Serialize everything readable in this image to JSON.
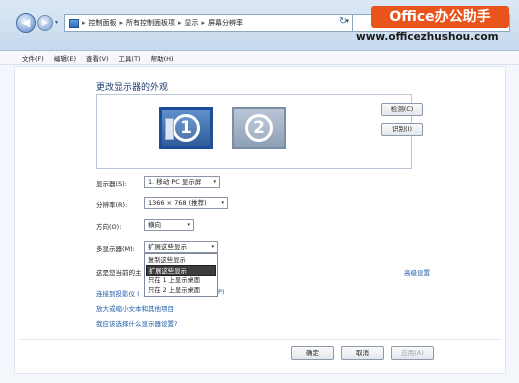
{
  "address_bar": {
    "crumbs": [
      "控制面板",
      "所有控制面板项",
      "显示",
      "屏幕分辨率"
    ],
    "back_glyph": "◀",
    "forward_glyph": "▶",
    "dropdown_glyph": "▾",
    "refresh_glyph": "↻",
    "sep_glyph": "▸"
  },
  "watermark": {
    "brand": "Office办公助手",
    "url": "www.officezhushou.com",
    "color": "#e8541c"
  },
  "menu": [
    "文件(F)",
    "编辑(E)",
    "查看(V)",
    "工具(T)",
    "帮助(H)"
  ],
  "page": {
    "title": "更改显示器的外观",
    "detect_label": "检测(C)",
    "identify_label": "识别(I)",
    "monitor1": "1",
    "monitor2": "2"
  },
  "settings": {
    "display_label": "显示器(S):",
    "display_value": "1. 移动 PC 显示屏",
    "resolution_label": "分辨率(R):",
    "resolution_value": "1366 × 768 (推荐)",
    "orientation_label": "方向(O):",
    "orientation_value": "横向",
    "multi_label": "多显示器(M):",
    "multi_value": "扩展这些显示",
    "main_label": "这是您当前的主",
    "advanced_link": "高级设置"
  },
  "multi_display_options": [
    "复制这些显示",
    "扩展这些显示",
    "只在 1 上显示桌面",
    "只在 2 上显示桌面"
  ],
  "links": {
    "projector": "连接到投影仪 (",
    "projector_suffix": "P)",
    "enlarge": "放大或缩小文本和其他项目",
    "choose": "我应该选择什么显示器设置?"
  },
  "footer": {
    "ok": "确定",
    "cancel": "取消",
    "apply": "应用(A)"
  }
}
